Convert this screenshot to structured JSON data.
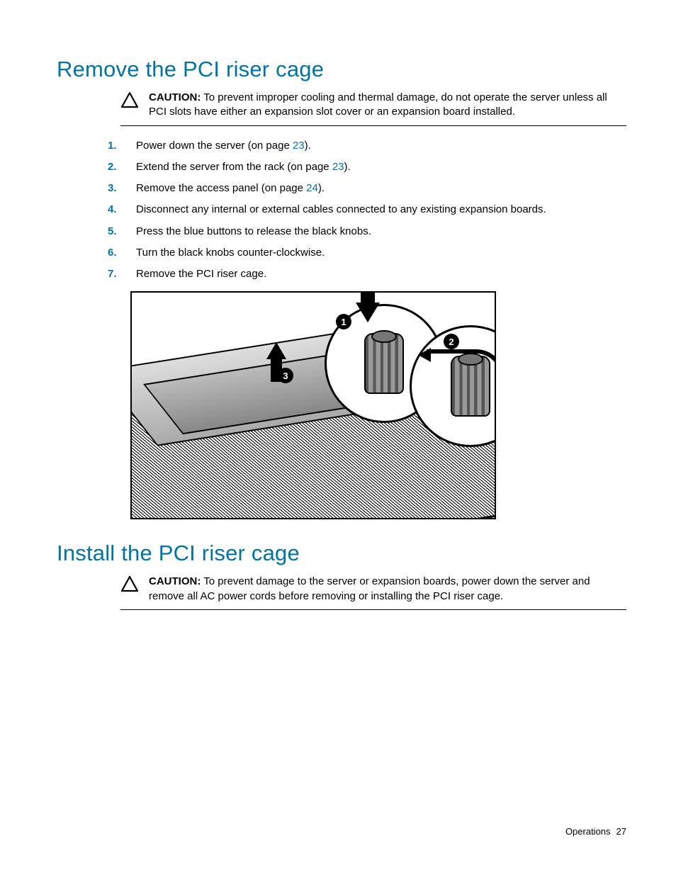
{
  "section1": {
    "heading": "Remove the PCI riser cage",
    "caution": {
      "label": "CAUTION:",
      "text": " To prevent improper cooling and thermal damage, do not operate the server unless all PCI slots have either an expansion slot cover or an expansion board installed."
    },
    "steps": [
      {
        "pre": "Power down the server (on page ",
        "ref": "23",
        "post": ")."
      },
      {
        "pre": "Extend the server from the rack (on page ",
        "ref": "23",
        "post": ")."
      },
      {
        "pre": "Remove the access panel (on page ",
        "ref": "24",
        "post": ")."
      },
      {
        "pre": "Disconnect any internal or external cables connected to any existing expansion boards.",
        "ref": "",
        "post": ""
      },
      {
        "pre": "Press the blue buttons to release the black knobs.",
        "ref": "",
        "post": ""
      },
      {
        "pre": "Turn the black knobs counter-clockwise.",
        "ref": "",
        "post": ""
      },
      {
        "pre": "Remove the PCI riser cage.",
        "ref": "",
        "post": ""
      }
    ],
    "figure": {
      "callouts": [
        "1",
        "2",
        "3"
      ]
    }
  },
  "section2": {
    "heading": "Install the PCI riser cage",
    "caution": {
      "label": "CAUTION:",
      "text": " To prevent damage to the server or expansion boards, power down the server and remove all AC power cords before removing or installing the PCI riser cage."
    }
  },
  "footer": {
    "section": "Operations",
    "page": "27"
  }
}
